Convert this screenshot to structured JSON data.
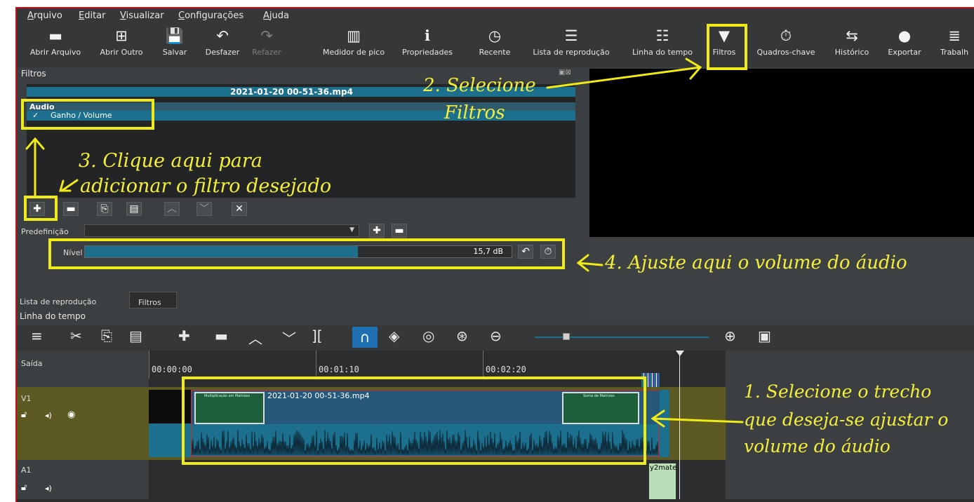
{
  "menu": [
    "Arquivo",
    "Editar",
    "Visualizar",
    "Configurações",
    "Ajuda"
  ],
  "toolbar": [
    {
      "label": "Abrir Arquivo",
      "icon": "folder-icon",
      "glyph": "▬"
    },
    {
      "label": "Abrir Outro",
      "icon": "open-other-icon",
      "glyph": "⊞"
    },
    {
      "label": "Salvar",
      "icon": "save-icon",
      "glyph": "💾"
    },
    {
      "label": "Desfazer",
      "icon": "undo-icon",
      "glyph": "↶"
    },
    {
      "label": "Refazer",
      "icon": "redo-icon",
      "glyph": "↷"
    },
    {
      "label": "Medidor de pico",
      "icon": "peak-meter-icon",
      "glyph": "▥"
    },
    {
      "label": "Propriedades",
      "icon": "info-icon",
      "glyph": "ℹ"
    },
    {
      "label": "Recente",
      "icon": "clock-icon",
      "glyph": "◷"
    },
    {
      "label": "Lista de reprodução",
      "icon": "list-icon",
      "glyph": "☰"
    },
    {
      "label": "Linha do tempo",
      "icon": "timeline-icon",
      "glyph": "☷"
    },
    {
      "label": "Filtros",
      "icon": "filter-icon",
      "glyph": "▼"
    },
    {
      "label": "Quadros-chave",
      "icon": "stopwatch-icon",
      "glyph": "⏱"
    },
    {
      "label": "Histórico",
      "icon": "history-icon",
      "glyph": "⇆"
    },
    {
      "label": "Exportar",
      "icon": "export-icon",
      "glyph": "●"
    },
    {
      "label": "Trabalh",
      "icon": "database-icon",
      "glyph": "≣"
    }
  ],
  "filters": {
    "panel_title": "Filtros",
    "clip_name": "2021-01-20 00-51-36.mp4",
    "category": "Audio",
    "item": "Ganho / Volume",
    "preset_label": "Predefinição",
    "level_label": "Nível",
    "level_value": "15,7 dB",
    "level_fraction": 0.64
  },
  "bottom_tabs": [
    "Lista de reprodução",
    "Filtros"
  ],
  "timeline": {
    "title": "Linha do tempo",
    "output_label": "Saída",
    "tracks": [
      "V1",
      "A1"
    ],
    "ticks": [
      "00:00:00",
      "00:01:10",
      "00:02:20"
    ],
    "clip_name": "2021-01-20 00-51-36.mp4",
    "clip2_name": "y2mate",
    "thumb1_title": "Multiplicação em Matrizes",
    "thumb2_title": "Soma de Matrizes",
    "zoom_fraction": 0.16
  },
  "annotations": {
    "a1": [
      "1. Selecione o trecho",
      "que deseja-se ajustar o",
      "volume do áudio"
    ],
    "a2": [
      "2. Selecione",
      "Filtros"
    ],
    "a3": [
      "3. Clique aqui para",
      "adicionar o filtro desejado"
    ],
    "a4": "4. Ajuste aqui o volume do áudio"
  },
  "colors": {
    "highlight": "#f0ea16",
    "clip": "#1d6f8e",
    "track": "#5c5a22",
    "frame_border": "#c0141c"
  }
}
